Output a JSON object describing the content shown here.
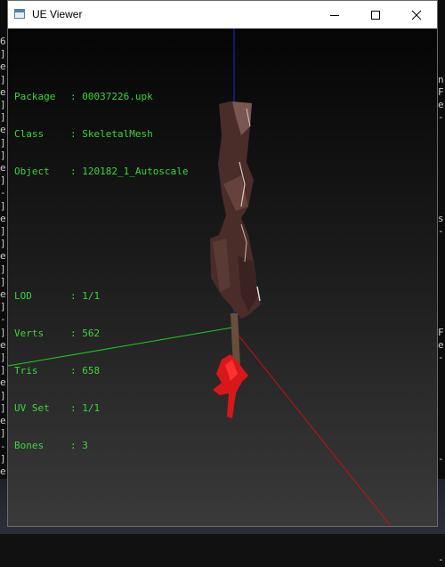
{
  "window": {
    "title": "UE Viewer",
    "controls": {
      "minimize": "minimize",
      "maximize": "maximize",
      "close": "close"
    }
  },
  "info": {
    "object_info": [
      {
        "key": "Package",
        "sep": ":",
        "value": "00037226.upk"
      },
      {
        "key": "Class",
        "sep": ":",
        "value": "SkeletalMesh"
      },
      {
        "key": "Object",
        "sep": ":",
        "value": "120182_1_Autoscale"
      }
    ],
    "mesh_stats": [
      {
        "key": "LOD",
        "sep": ":",
        "value": "1/1"
      },
      {
        "key": "Verts",
        "sep": ":",
        "value": "562"
      },
      {
        "key": "Tris",
        "sep": ":",
        "value": "658"
      },
      {
        "key": "UV Set",
        "sep": ":",
        "value": "1/1"
      },
      {
        "key": "Bones",
        "sep": ":",
        "value": "3"
      }
    ]
  },
  "background_console": {
    "left_chars": "6\n]\ne\n]\ne\n]\n]\ne\n]\n]\ne\n]\n-\n]\ne\n]\n]\ne\n]\n]\ne\n]\n-\n]\ne\n]\n]\ne\n]\n]\ne\n]\n-\n]\ne\n]",
    "right_chars": "\n\n\nn\nF\ne\n-\n\n\n\n\n\n\n\ns\n-\n\n\n\n\n\n\n\nF\ne\n-\n\n\n\n\n\n\n\n-\n\n\n\n\n\n\n\n-"
  },
  "colors": {
    "info_text": "#38d838",
    "axis_x": "#d01010",
    "axis_y": "#10c010",
    "axis_z": "#1020d0"
  }
}
